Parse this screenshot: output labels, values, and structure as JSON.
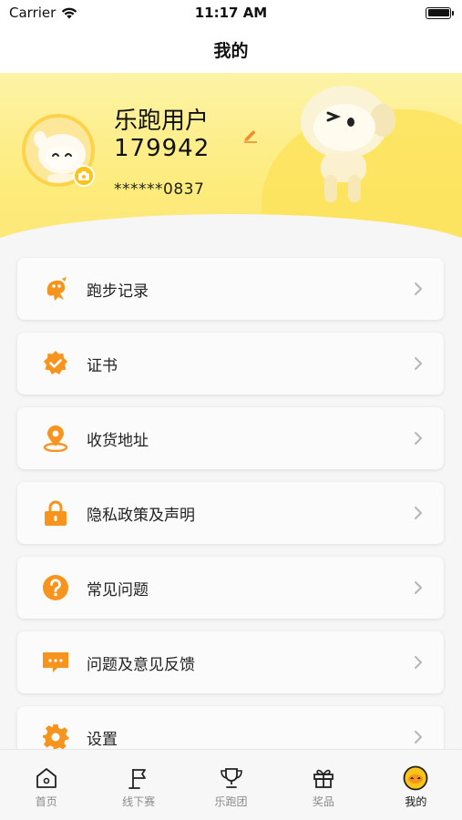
{
  "status_bar": {
    "carrier": "Carrier",
    "time": "11:17 AM"
  },
  "nav": {
    "title": "我的"
  },
  "profile": {
    "name": "乐跑用户",
    "id": "179942",
    "phone": "******0837"
  },
  "menu": {
    "items": [
      {
        "label": "跑步记录",
        "icon": "running-record-icon"
      },
      {
        "label": "证书",
        "icon": "certificate-icon"
      },
      {
        "label": "收货地址",
        "icon": "location-pin-icon"
      },
      {
        "label": "隐私政策及声明",
        "icon": "lock-icon"
      },
      {
        "label": "常见问题",
        "icon": "question-icon"
      },
      {
        "label": "问题及意见反馈",
        "icon": "feedback-message-icon"
      },
      {
        "label": "设置",
        "icon": "gear-icon"
      }
    ]
  },
  "tabs": [
    {
      "label": "首页",
      "icon": "home-icon"
    },
    {
      "label": "线下赛",
      "icon": "flag-icon"
    },
    {
      "label": "乐跑团",
      "icon": "trophy-icon"
    },
    {
      "label": "奖品",
      "icon": "gift-icon"
    },
    {
      "label": "我的",
      "icon": "smiley-icon",
      "active": true
    }
  ],
  "colors": {
    "accent": "#f7941d",
    "header_yellow": "#fdeb7a",
    "badge_yellow": "#fcc419"
  }
}
